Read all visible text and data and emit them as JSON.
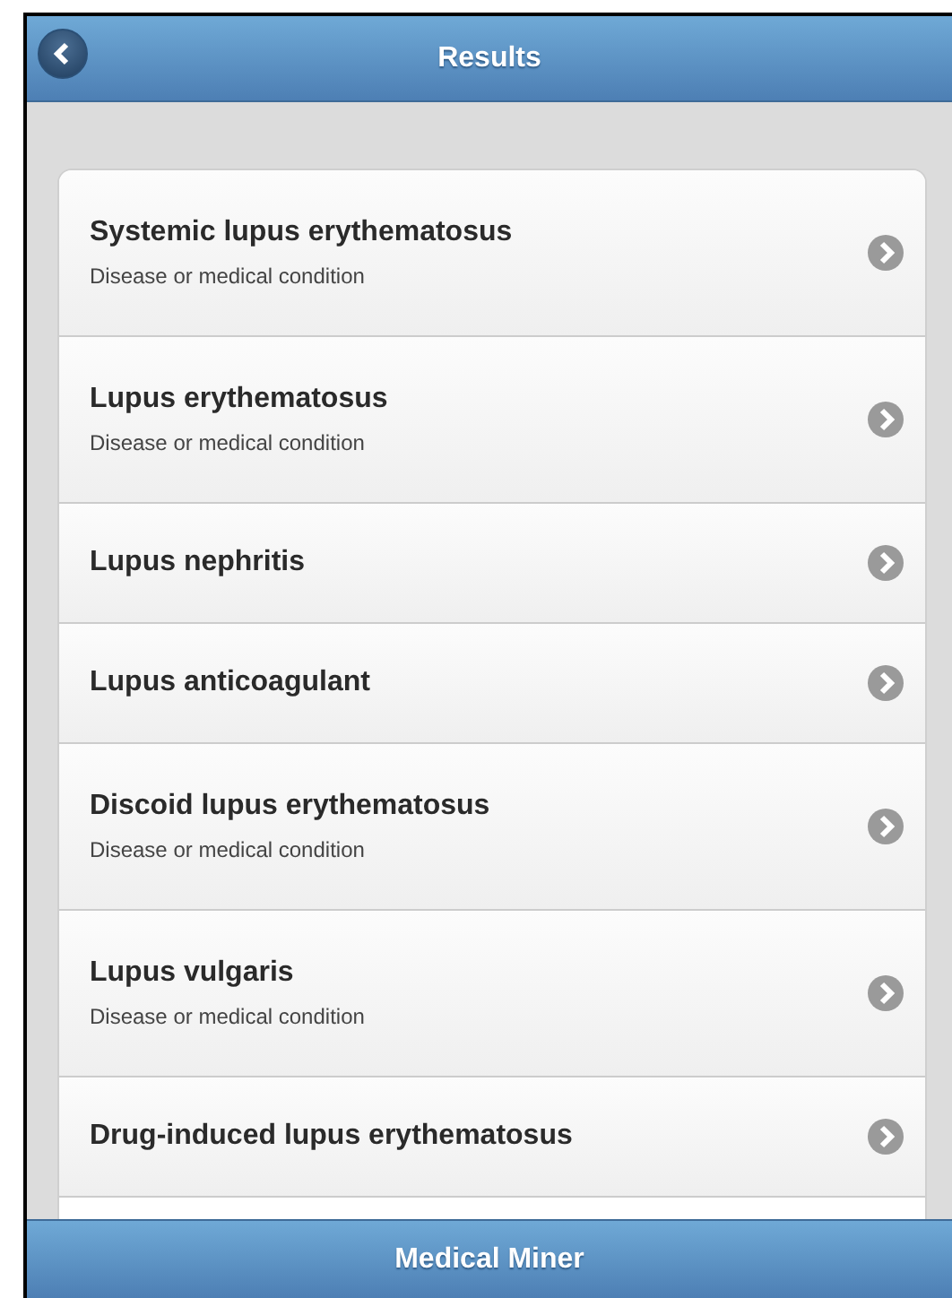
{
  "header": {
    "title": "Results"
  },
  "results": [
    {
      "title": "Systemic lupus erythematosus",
      "subtitle": "Disease or medical condition"
    },
    {
      "title": "Lupus erythematosus",
      "subtitle": "Disease or medical condition"
    },
    {
      "title": "Lupus nephritis"
    },
    {
      "title": "Lupus anticoagulant"
    },
    {
      "title": "Discoid lupus erythematosus",
      "subtitle": "Disease or medical condition"
    },
    {
      "title": "Lupus vulgaris",
      "subtitle": "Disease or medical condition"
    },
    {
      "title": "Drug-induced lupus erythematosus"
    }
  ],
  "footer": {
    "title": "Medical Miner"
  }
}
